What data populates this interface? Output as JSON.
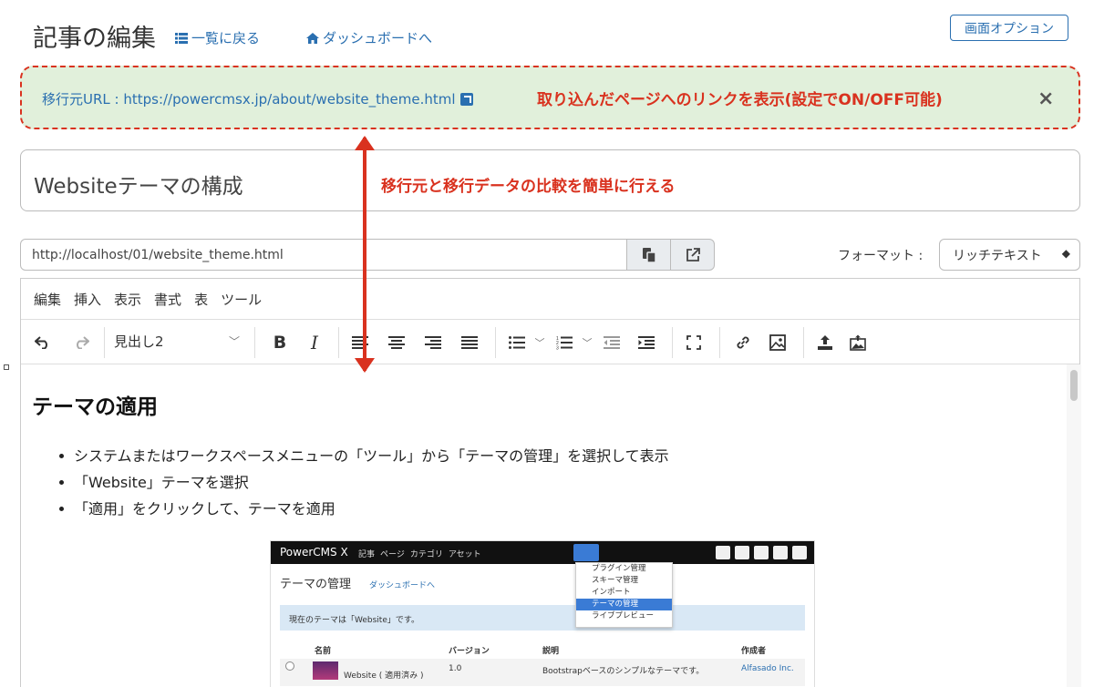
{
  "header": {
    "title": "記事の編集",
    "list_link": "一覧に戻る",
    "dashboard_link": "ダッシュボードへ",
    "screen_options": "画面オプション"
  },
  "source_alert": {
    "label": "移行元URL : https://powercmsx.jp/about/website_theme.html",
    "note": "取り込んだページへのリンクを表示(設定でON/OFF可能)",
    "close": "×"
  },
  "title_field": {
    "value": "Websiteテーマの構成"
  },
  "compare_note": "移行元と移行データの比較を簡単に行える",
  "permalink": {
    "value": "http://localhost/01/website_theme.html"
  },
  "format": {
    "label": "フォーマット :",
    "selected": "リッチテキスト"
  },
  "editor": {
    "menu": [
      "編集",
      "挿入",
      "表示",
      "書式",
      "表",
      "ツール"
    ],
    "block_format": "見出し2",
    "heading": "テーマの適用",
    "bullets": [
      "システムまたはワークスペースメニューの「ツール」から「テーマの管理」を選択して表示",
      "「Website」テーマを選択",
      "「適用」をクリックして、テーマを適用"
    ]
  },
  "embedded_screenshot": {
    "brand": "PowerCMS X",
    "nav": [
      "記事",
      "ページ",
      "カテゴリ",
      "アセット"
    ],
    "page_title": "テーマの管理",
    "dashboard_link": "ダッシュボードへ",
    "info": "現在のテーマは「Website」です。",
    "columns": [
      "名前",
      "バージョン",
      "説明",
      "作成者"
    ],
    "row": [
      "Website ( 適用済み )",
      "1.0",
      "Bootstrapベースのシンプルなテーマです。",
      "Alfasado Inc."
    ],
    "dropdown": [
      "プラグイン管理",
      "スキーマ管理",
      "インポート",
      "テーマの管理",
      "ライブプレビュー"
    ]
  },
  "colors": {
    "accent": "#2a6fb0",
    "annotation": "#d9321f",
    "alert_bg": "#e1f0db"
  }
}
